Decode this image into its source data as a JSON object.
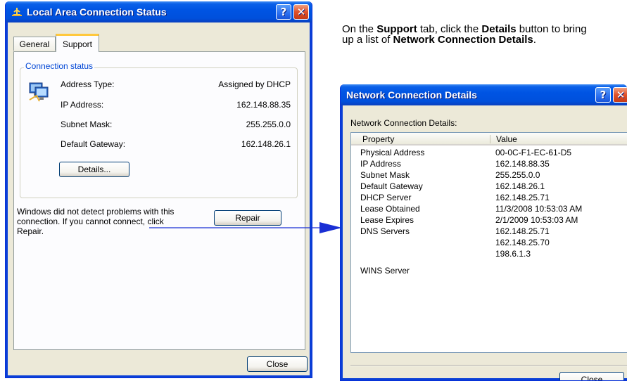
{
  "status_window": {
    "title": "Local Area Connection Status",
    "tabs": [
      "General",
      "Support"
    ],
    "group_label": "Connection status",
    "rows": [
      {
        "label": "Address Type:",
        "value": "Assigned by DHCP"
      },
      {
        "label": "IP Address:",
        "value": "162.148.88.35"
      },
      {
        "label": "Subnet Mask:",
        "value": "255.255.0.0"
      },
      {
        "label": "Default Gateway:",
        "value": "162.148.26.1"
      }
    ],
    "details_button": "Details...",
    "message": "Windows did not detect problems with this connection. If you cannot connect, click Repair.",
    "repair_button": "Repair",
    "close_button": "Close",
    "help_glyph": "?",
    "close_glyph": "✕"
  },
  "instruction": {
    "t1": "On the ",
    "t2": "Support",
    "t3": " tab, click the ",
    "t4": "Details",
    "t5": " button to bring up a list of ",
    "t6": "Network Connection Details",
    "t7": "."
  },
  "details_window": {
    "title": "Network Connection Details",
    "caption": "Network Connection Details:",
    "col_property": "Property",
    "col_value": "Value",
    "rows": [
      {
        "property": "Physical Address",
        "value": "00-0C-F1-EC-61-D5"
      },
      {
        "property": "IP Address",
        "value": "162.148.88.35"
      },
      {
        "property": "Subnet Mask",
        "value": "255.255.0.0"
      },
      {
        "property": "Default Gateway",
        "value": "162.148.26.1"
      },
      {
        "property": "DHCP Server",
        "value": "162.148.25.71"
      },
      {
        "property": "Lease Obtained",
        "value": "11/3/2008 10:53:03 AM"
      },
      {
        "property": "Lease Expires",
        "value": "2/1/2009 10:53:03 AM"
      },
      {
        "property": "DNS Servers",
        "value": "162.148.25.71"
      },
      {
        "property": "",
        "value": "162.148.25.70"
      },
      {
        "property": "",
        "value": "198.6.1.3"
      },
      {
        "property": "WINS Server",
        "value": ""
      }
    ],
    "close_button": "Close",
    "help_glyph": "?",
    "close_glyph": "✕"
  },
  "colors": {
    "title_blue": "#0054e3",
    "arrow_blue": "#1a2fd4"
  },
  "icons": [
    "network-icon",
    "help-icon",
    "close-icon",
    "network-connection-icon"
  ]
}
